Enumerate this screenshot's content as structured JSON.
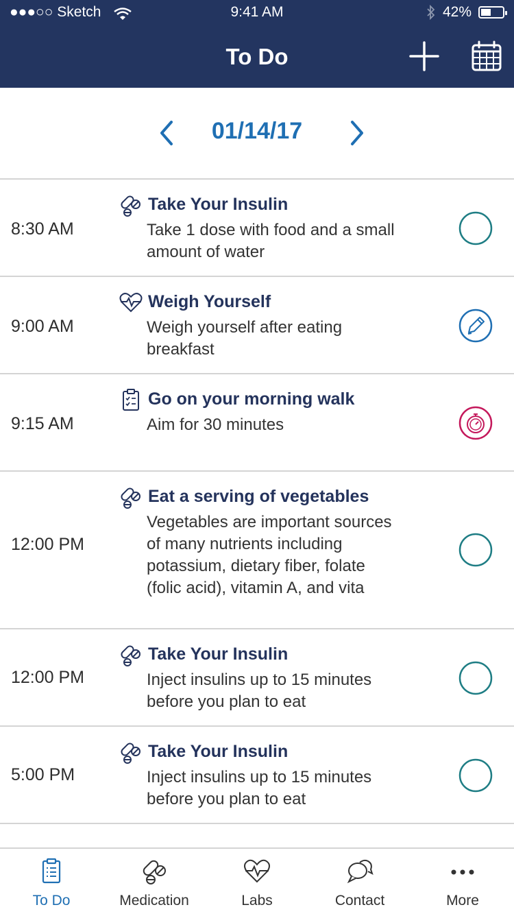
{
  "status": {
    "carrier": "●●●○○ Sketch",
    "time": "9:41 AM",
    "battery": "42%"
  },
  "header": {
    "title": "To Do"
  },
  "date": {
    "current": "01/14/17"
  },
  "tasks": [
    {
      "time": "8:30 AM",
      "type_icon": "pills-icon",
      "title": "Take Your Insulin",
      "desc": "Take 1 dose with food and a small amount of water",
      "action": "circle-check"
    },
    {
      "time": "9:00 AM",
      "type_icon": "heartbeat-icon",
      "title": "Weigh Yourself",
      "desc": "Weigh yourself after eating breakfast",
      "action": "pencil"
    },
    {
      "time": "9:15 AM",
      "type_icon": "clipboard-icon",
      "title": "Go on your morning walk",
      "desc": "Aim for 30 minutes",
      "action": "stopwatch"
    },
    {
      "time": "12:00 PM",
      "type_icon": "pills-icon",
      "title": "Eat a serving of vegetables",
      "desc": "Vegetables are important sources of many nutrients including potassium, dietary fiber, folate (folic acid), vitamin A, and vita",
      "action": "circle-check"
    },
    {
      "time": "12:00 PM",
      "type_icon": "pills-icon",
      "title": "Take Your Insulin",
      "desc": "Inject insulins up to 15 minutes before you plan to eat",
      "action": "circle-check"
    },
    {
      "time": "5:00 PM",
      "type_icon": "pills-icon",
      "title": "Take Your Insulin",
      "desc": "Inject insulins up to 15 minutes before you plan to eat",
      "action": "circle-check"
    }
  ],
  "tabs": [
    {
      "label": "To Do",
      "icon": "clipboard-icon",
      "active": true
    },
    {
      "label": "Medication",
      "icon": "pills-icon",
      "active": false
    },
    {
      "label": "Labs",
      "icon": "heartbeat-icon",
      "active": false
    },
    {
      "label": "Contact",
      "icon": "chat-bubbles-icon",
      "active": false
    },
    {
      "label": "More",
      "icon": "more-dots-icon",
      "active": false
    }
  ],
  "colors": {
    "header_bg": "#233560",
    "accent_blue": "#1f6fb3",
    "teal": "#1e7d84",
    "stopwatch_red": "#c4185b",
    "title_navy": "#24335c"
  }
}
